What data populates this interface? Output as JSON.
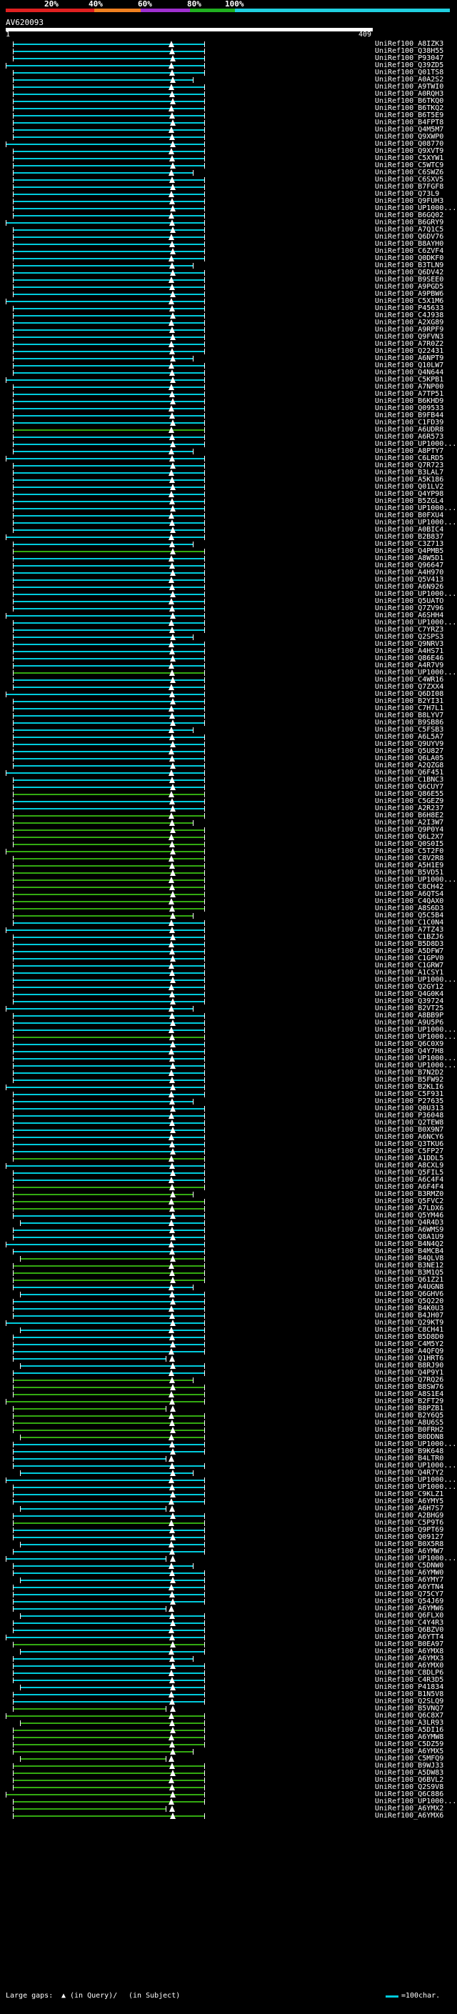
{
  "scale": {
    "labels": [
      "20%",
      "40%",
      "60%",
      "80%",
      "100%"
    ],
    "colors": [
      "#e02020",
      "#f08020",
      "#a030d0",
      "#20b020",
      "#20d0e0"
    ]
  },
  "query": {
    "name": "AV620093",
    "start": "1",
    "end": "409"
  },
  "colors": {
    "high": "#00ccdd",
    "low": "#33aa11",
    "tick": "#ffffff"
  },
  "hits": [
    "UniRef100_A8IZK3",
    "UniRef100_Q38H55",
    "UniRef100_P93047",
    "UniRef100_Q39ZD5",
    "UniRef100_Q01TS8",
    "UniRef100_A0A2S2",
    "UniRef100_A9TWI0",
    "UniRef100_A0RQH3",
    "UniRef100_B6TKQ0",
    "UniRef100_B6TKQ2",
    "UniRef100_B6T5E9",
    "UniRef100_B4FPT8",
    "UniRef100_Q4M5M7",
    "UniRef100_Q9XWP0",
    "UniRef100_Q08770",
    "UniRef100_Q9XVT9",
    "UniRef100_C5XYW1",
    "UniRef100_C5WTC9",
    "UniRef100_C6SWZ6",
    "UniRef100_C6SXV5",
    "UniRef100_B7FGF8",
    "UniRef100_Q73L9",
    "UniRef100_Q9FUH3",
    "UniRef100_UP1000...",
    "UniRef100_B6GQ02",
    "UniRef100_B6GRY9",
    "UniRef100_A7Q1C5",
    "UniRef100_Q6DV76",
    "UniRef100_B8AYH0",
    "UniRef100_C6ZVF4",
    "UniRef100_Q0DKF0",
    "UniRef100_B3TLN9",
    "UniRef100_Q6DV42",
    "UniRef100_B9SEE0",
    "UniRef100_A9PGD5",
    "UniRef100_A9PBW6",
    "UniRef100_C5X1M6",
    "UniRef100_P45633",
    "UniRef100_C4J938",
    "UniRef100_A2XG89",
    "UniRef100_A9RPF9",
    "UniRef100_Q9FVN3",
    "UniRef100_A7R0Z2",
    "UniRef100_Q22431",
    "UniRef100_A6NPT9",
    "UniRef100_Q10LW7",
    "UniRef100_Q4N644",
    "UniRef100_C5KPB1",
    "UniRef100_A7NP00",
    "UniRef100_A7TP51",
    "UniRef100_B6KHD9",
    "UniRef100_Q09533",
    "UniRef100_B9FB44",
    "UniRef100_C1FD39",
    "UniRef100_A6UDR8",
    "UniRef100_A6R573",
    "UniRef100_UP1000...",
    "UniRef100_A8PTY7",
    "UniRef100_C6LRD5",
    "UniRef100_Q7R723",
    "UniRef100_B3LAL7",
    "UniRef100_A5K186",
    "UniRef100_Q01LV2",
    "UniRef100_Q4YP98",
    "UniRef100_B5ZGL4",
    "UniRef100_UP1000...",
    "UniRef100_B0FXU4",
    "UniRef100_UP1000...",
    "UniRef100_A0BIC4",
    "UniRef100_B2B837",
    "UniRef100_C3Z713",
    "UniRef100_Q4PMB5",
    "UniRef100_A8W5D1",
    "UniRef100_Q96647",
    "UniRef100_A4H970",
    "UniRef100_Q5V413",
    "UniRef100_A6N926",
    "UniRef100_UP1000...",
    "UniRef100_Q5UATO",
    "UniRef100_Q7ZV96",
    "UniRef100_A6SHH4",
    "UniRef100_UP1000...",
    "UniRef100_C7YRZ3",
    "UniRef100_Q2SPS3",
    "UniRef100_Q9NRV3",
    "UniRef100_A4HS71",
    "UniRef100_Q86E46",
    "UniRef100_A4R7V9",
    "UniRef100_UP1000...",
    "UniRef100_C4WR16",
    "UniRef100_Q7ZXX4",
    "UniRef100_Q6DI08",
    "UniRef100_B2YI31",
    "UniRef100_C7H7L1",
    "UniRef100_B8LYV7",
    "UniRef100_B9SB86",
    "UniRef100_C5FSB3",
    "UniRef100_A6L5A7",
    "UniRef100_Q9UYV9",
    "UniRef100_Q5U827",
    "UniRef100_Q6LA05",
    "UniRef100_A2QZG8",
    "UniRef100_Q6F451",
    "UniRef100_C1BNC3",
    "UniRef100_Q6CUY7",
    "UniRef100_Q86E55",
    "UniRef100_C5GEZ9",
    "UniRef100_A2R237",
    "UniRef100_B6H8E2",
    "UniRef100_A2I3W7",
    "UniRef100_Q9P0Y4",
    "UniRef100_Q6L2X7",
    "UniRef100_Q0S0I5",
    "UniRef100_C5T2F0",
    "UniRef100_C8V2R8",
    "UniRef100_A5H1E9",
    "UniRef100_B5VD51",
    "UniRef100_UP1000...",
    "UniRef100_C8CH42",
    "UniRef100_A6QTS4",
    "UniRef100_C4QAX0",
    "UniRef100_A8S6D3",
    "UniRef100_Q5C5B4",
    "UniRef100_C1C0N4",
    "UniRef100_A7TZ43",
    "UniRef100_C1BZJ6",
    "UniRef100_B5D8D3",
    "UniRef100_A5DFW7",
    "UniRef100_C1GPV0",
    "UniRef100_C1GRW7",
    "UniRef100_A1CSY1",
    "UniRef100_UP1000...",
    "UniRef100_Q2GY12",
    "UniRef100_Q4G0K4",
    "UniRef100_Q39724",
    "UniRef100_B2VT25",
    "UniRef100_A8BB9P",
    "UniRef100_A9U5P6",
    "UniRef100_UP1000...",
    "UniRef100_UP1000...",
    "UniRef100_Q6C0X9",
    "UniRef100_Q4Y7H8",
    "UniRef100_UP1000...",
    "UniRef100_UP1000...",
    "UniRef100_B7N2D2",
    "UniRef100_B5FW92",
    "UniRef100_B2KLI6",
    "UniRef100_C5F931",
    "UniRef100_P27635",
    "UniRef100_Q0U313",
    "UniRef100_P36048",
    "UniRef100_Q2TEW8",
    "UniRef100_B0X9N7",
    "UniRef100_A6NCY6",
    "UniRef100_Q3TKU6",
    "UniRef100_C5FP27",
    "UniRef100_A1DDL5",
    "UniRef100_A8CXL9",
    "UniRef100_Q5FIL5",
    "UniRef100_A6C4F4",
    "UniRef100_A6F4F4",
    "UniRef100_B3RMZ0",
    "UniRef100_Q5FVC2",
    "UniRef100_A7LDX6",
    "UniRef100_Q5YM46",
    "UniRef100_Q4R4D3",
    "UniRef100_A6WMS9",
    "UniRef100_Q8A1U9",
    "UniRef100_B4N4Q2",
    "UniRef100_B4MCB4",
    "UniRef100_B4QLV8",
    "UniRef100_B3NE12",
    "UniRef100_B3M1Q5",
    "UniRef100_Q61Z21",
    "UniRef100_A4UGN8",
    "UniRef100_Q6GHV6",
    "UniRef100_Q5Q220",
    "UniRef100_B4K0U3",
    "UniRef100_B4JH07",
    "UniRef100_Q29KT9",
    "UniRef100_C8CH41",
    "UniRef100_B5D8D0",
    "UniRef100_C4M5Y2",
    "UniRef100_A4QFQ9",
    "UniRef100_Q1HRT6",
    "UniRef100_B8RJ90",
    "UniRef100_Q4P9Y1",
    "UniRef100_Q7RQ26",
    "UniRef100_B8SW76",
    "UniRef100_A8S1E4",
    "UniRef100_B2FT29",
    "UniRef100_B8PZB1",
    "UniRef100_B2Y6Q5",
    "UniRef100_A8U6S5",
    "UniRef100_B0FRH2",
    "UniRef100_B0DDN8",
    "UniRef100_UP1000...",
    "UniRef100_B9K648",
    "UniRef100_B4LTR0",
    "UniRef100_UP1000...",
    "UniRef100_Q4R7Y2",
    "UniRef100_UP1000...",
    "UniRef100_UP1000...",
    "UniRef100_C9KLZ1",
    "UniRef100_A6YMY5",
    "UniRef100_A6H7S7",
    "UniRef100_A2BHG9",
    "UniRef100_C5P9T6",
    "UniRef100_Q9PT69",
    "UniRef100_Q09127",
    "UniRef100_B0X5R8",
    "UniRef100_A6YMW7",
    "UniRef100_UP1000...",
    "UniRef100_C5DNW0",
    "UniRef100_A6YMW0",
    "UniRef100_A6YMY7",
    "UniRef100_A6YTN4",
    "UniRef100_Q75CY7",
    "UniRef100_Q54J69",
    "UniRef100_A6YMW6",
    "UniRef100_Q6FLX0",
    "UniRef100_C4Y4R3",
    "UniRef100_Q6BZV0",
    "UniRef100_A6YTT4",
    "UniRef100_B0EA97",
    "UniRef100_A6YMX8",
    "UniRef100_A6YMX3",
    "UniRef100_A6YMX0",
    "UniRef100_C8DLP6",
    "UniRef100_C4R3D5",
    "UniRef100_P41834",
    "UniRef100_B1N5V8",
    "UniRef100_Q2SLQ9",
    "UniRef100_B5VNQ7",
    "UniRef100_Q6C8X7",
    "UniRef100_A3LR93",
    "UniRef100_A5DI16",
    "UniRef100_A6YMW8",
    "UniRef100_C5DZ59",
    "UniRef100_A6YMX5",
    "UniRef100_C5MFQ9",
    "UniRef100_B9WJ33",
    "UniRef100_A5DW83",
    "UniRef100_Q6BVL2",
    "UniRef100_Q2S9V8",
    "UniRef100_Q6C886",
    "UniRef100_UP1000...",
    "UniRef100_A6YMX2",
    "UniRef100_A6YMX6"
  ],
  "legend": {
    "large_gaps": "Large gaps:",
    "in_query": "(in Query)/",
    "in_subject": "(in Subject)",
    "scale": "=100char."
  }
}
